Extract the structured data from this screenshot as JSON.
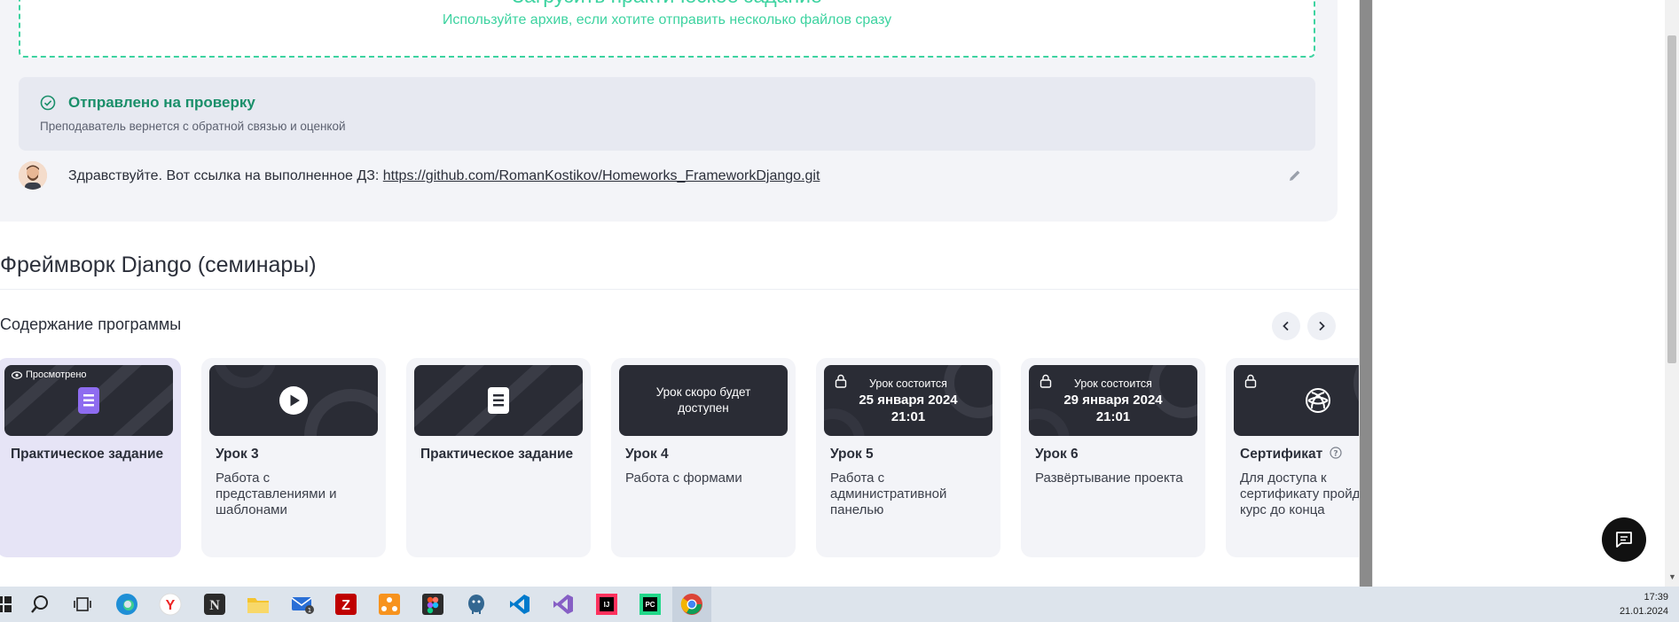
{
  "homework": {
    "upload_title": "Загрузить практическое задание",
    "upload_subtitle": "Используйте архив, если хотите отправить несколько файлов сразу",
    "status_title": "Отправлено на проверку",
    "status_subtitle": "Преподаватель вернется с обратной связью и оценкой",
    "comment_prefix": "Здравствуйте. Вот ссылка на выполненное ДЗ: ",
    "comment_link": "https://github.com/RomanKostikov/Homeworks_FrameworkDjango.git"
  },
  "course": {
    "title": "Фреймворк Django (семинары)",
    "section_title": "Содержание программы"
  },
  "cards": [
    {
      "badge": "Просмотрено",
      "title": "Практическое задание",
      "desc": "",
      "thumb": "doc-purple"
    },
    {
      "title": "Урок 3",
      "desc": "Работа с представлениями и шаблонами",
      "thumb": "play"
    },
    {
      "title": "Практическое задание",
      "desc": "",
      "thumb": "doc"
    },
    {
      "thumb_text": "Урок скоро будет доступен",
      "title": "Урок 4",
      "desc": "Работа с формами"
    },
    {
      "thumb_line1": "Урок состоится",
      "thumb_line2": "25 января 2024",
      "thumb_line3": "21:01",
      "title": "Урок 5",
      "desc": "Работа с административной панелью"
    },
    {
      "thumb_line1": "Урок состоится",
      "thumb_line2": "29 января 2024",
      "thumb_line3": "21:01",
      "title": "Урок 6",
      "desc": "Развёртывание проекта"
    },
    {
      "title": "Сертификат",
      "desc": "Для доступа к сертификату пройдите курс до конца",
      "thumb": "cert"
    }
  ],
  "taskbar": {
    "time": "17:39",
    "date": "21.01.2024",
    "mail_badge": "1"
  },
  "colors": {
    "accent_green": "#3dd3a0",
    "status_green": "#1a8f6a",
    "active_card": "#e6e4f6",
    "thumb_dark": "#2a2c35"
  }
}
